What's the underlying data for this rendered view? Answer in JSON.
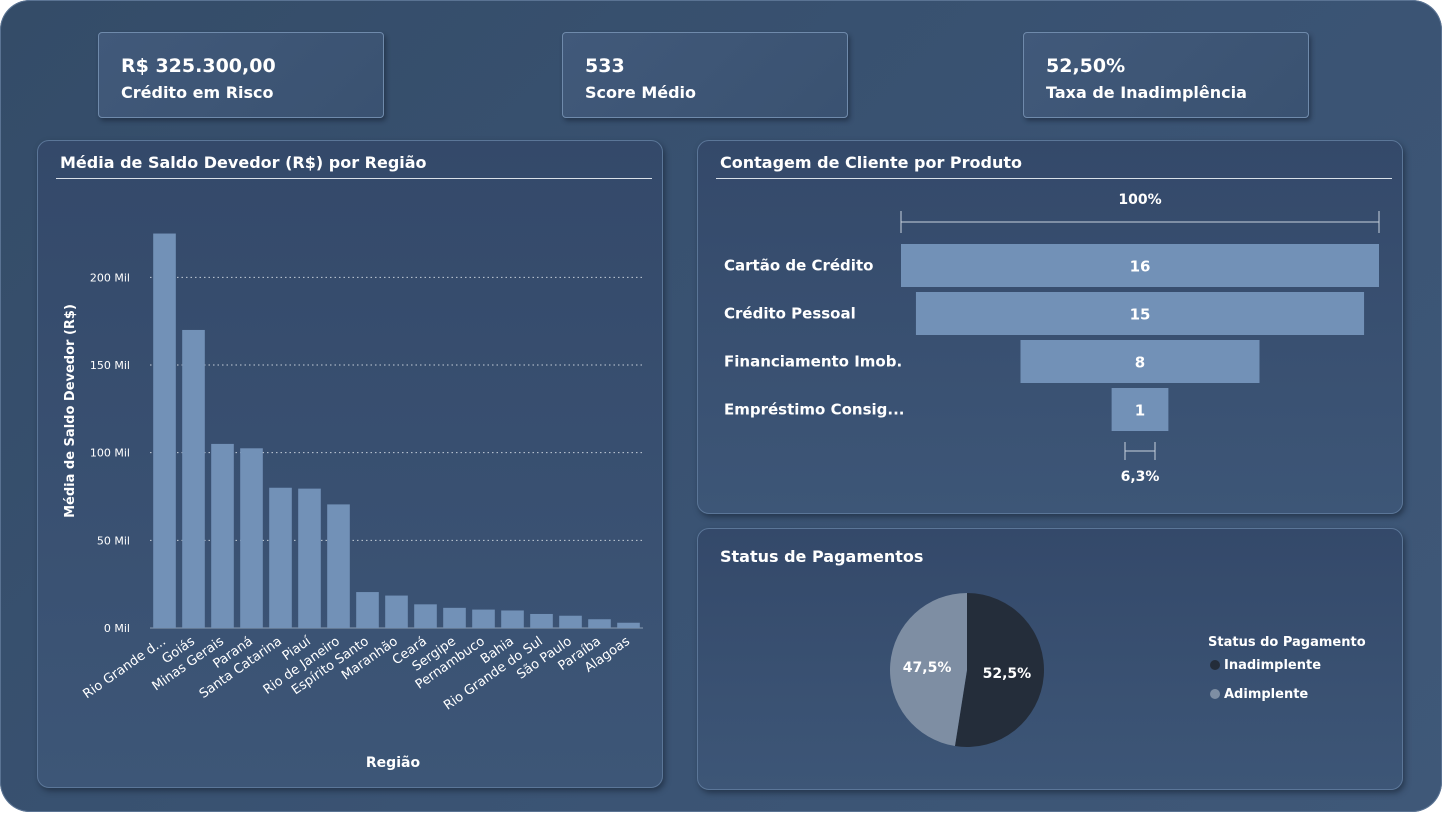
{
  "kpis": [
    {
      "value": "R$ 325.300,00",
      "label": "Crédito em Risco"
    },
    {
      "value": "533",
      "label": "Score Médio"
    },
    {
      "value": "52,50%",
      "label": "Taxa de Inadimplência"
    }
  ],
  "colors": {
    "bar": "#7291b7",
    "inadimplente": "#242d3a",
    "adimplente": "#7e8ea3",
    "grid": "#c3cdd8"
  },
  "region_chart": {
    "title": "Média de Saldo Devedor (R$) por Região",
    "chart_data": {
      "type": "bar",
      "title": "Média de Saldo Devedor (R$) por Região",
      "xlabel": "Região",
      "ylabel": "Média de Saldo Devedor (R$)",
      "ylim": [
        0,
        235000
      ],
      "yticks": [
        {
          "value": 0,
          "label": "0 Mil"
        },
        {
          "value": 50000,
          "label": "50 Mil"
        },
        {
          "value": 100000,
          "label": "100 Mil"
        },
        {
          "value": 150000,
          "label": "150 Mil"
        },
        {
          "value": 200000,
          "label": "200 Mil"
        }
      ],
      "grid": true,
      "categories": [
        "Rio Grande d...",
        "Goiás",
        "Minas Gerais",
        "Paraná",
        "Santa Catarina",
        "Piauí",
        "Rio de Janeiro",
        "Espírito Santo",
        "Maranhão",
        "Ceará",
        "Sergipe",
        "Pernambuco",
        "Bahia",
        "Rio Grande do Sul",
        "São Paulo",
        "Paraíba",
        "Alagoas"
      ],
      "values": [
        225000,
        170000,
        105000,
        102500,
        80000,
        79500,
        70500,
        20500,
        18500,
        13500,
        11500,
        10500,
        10000,
        8000,
        7000,
        5000,
        3000
      ]
    }
  },
  "funnel_chart": {
    "title": "Contagem de Cliente por Produto",
    "chart_data": {
      "type": "funnel",
      "top_label": "100%",
      "bottom_label": "6,3%",
      "categories": [
        "Cartão de Crédito",
        "Crédito Pessoal",
        "Financiamento Imob.",
        "Empréstimo Consig..."
      ],
      "values": [
        16,
        15,
        8,
        1
      ]
    }
  },
  "status_chart": {
    "title": "Status de Pagamentos",
    "chart_data": {
      "type": "pie",
      "labels": [
        "Inadimplente",
        "Adimplente"
      ],
      "values": [
        52.5,
        47.5
      ],
      "value_labels": [
        "52,5%",
        "47,5%"
      ],
      "legend_position": "right"
    },
    "legend": {
      "title": "Status do Pagamento",
      "items": [
        "Inadimplente",
        "Adimplente"
      ]
    }
  }
}
